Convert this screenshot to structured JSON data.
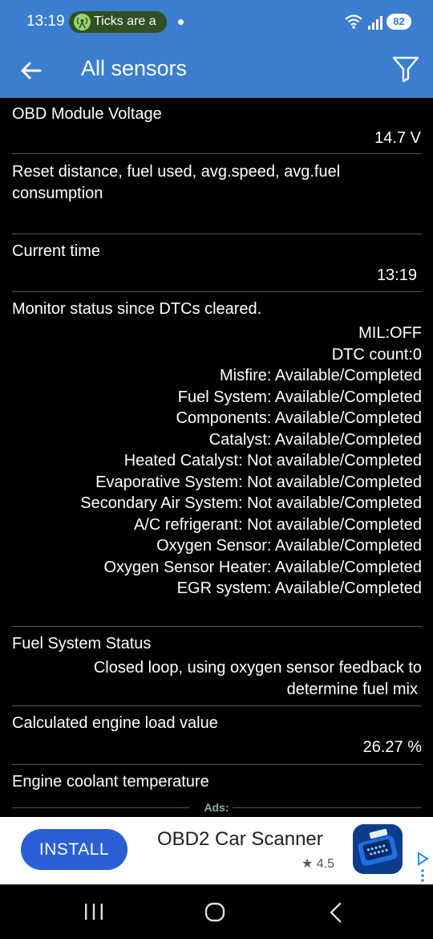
{
  "status_bar": {
    "time": "13:19",
    "notification_text": "Ticks are a",
    "battery": "82"
  },
  "app_bar": {
    "title": "All sensors"
  },
  "sensors": [
    {
      "name": "OBD Module Voltage",
      "value": "14.7 V"
    },
    {
      "name": "Reset distance, fuel used, avg.speed, avg.fuel consumption",
      "value": ""
    },
    {
      "name": "Current time",
      "value": "13:19"
    },
    {
      "name": "Monitor status since DTCs cleared.",
      "lines": [
        "MIL:OFF",
        "DTC count:0",
        "Misfire: Available/Completed",
        "Fuel System: Available/Completed",
        "Components: Available/Completed",
        "Catalyst: Available/Completed",
        "Heated Catalyst: Not available/Completed",
        "Evaporative System: Not available/Completed",
        "Secondary Air System: Not available/Completed",
        "A/C refrigerant: Not available/Completed",
        "Oxygen Sensor: Available/Completed",
        "Oxygen Sensor Heater: Available/Completed",
        "EGR system: Available/Completed"
      ]
    },
    {
      "name": "Fuel System Status",
      "lines": [
        "Closed loop, using oxygen sensor feedback to",
        "determine fuel mix"
      ]
    },
    {
      "name": "Calculated engine load value",
      "value": "26.27 %"
    },
    {
      "name": "Engine coolant temperature",
      "value": ""
    }
  ],
  "ads": {
    "label": "Ads:",
    "install_label": "INSTALL",
    "app_name": "OBD2 Car Scanner",
    "rating": "4.5"
  },
  "colors": {
    "app_bar": "#3b7dcf",
    "background": "#000000",
    "divider": "#4a5766",
    "install_button": "#2a5fd6"
  }
}
